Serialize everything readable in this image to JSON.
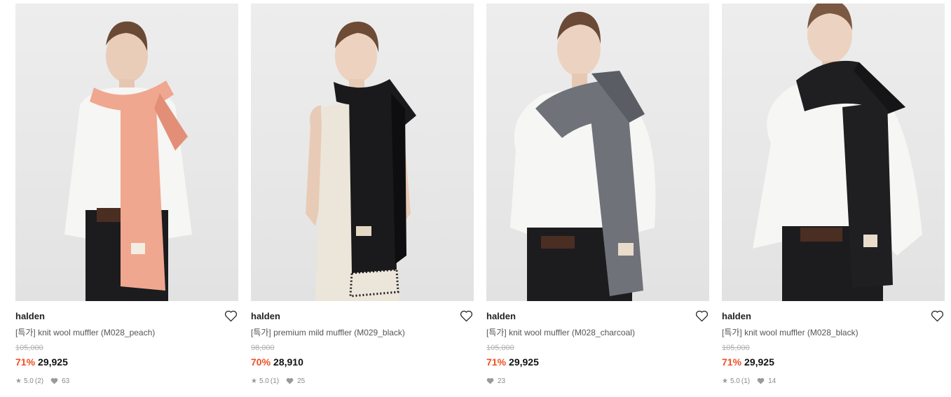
{
  "products": [
    {
      "brand": "halden",
      "name": "[특가] knit wool muffler (M028_peach)",
      "original_price": "105,000",
      "discount": "71%",
      "price": "29,925",
      "rating": "5.0",
      "reviews": "(2)",
      "likes": "63",
      "scarf_color": "#f0a78f",
      "scarf_shade": "#e38f77",
      "top_color": "#f6f6f4",
      "bottom_color": "#1c1c1e"
    },
    {
      "brand": "halden",
      "name": "[특가] premium mild muffler (M029_black)",
      "original_price": "98,000",
      "discount": "70%",
      "price": "28,910",
      "rating": "5.0",
      "reviews": "(1)",
      "likes": "25",
      "scarf_color": "#1a1a1c",
      "scarf_shade": "#0e0e10",
      "top_color": "#ece6da",
      "bottom_color": "#e9e2d5"
    },
    {
      "brand": "halden",
      "name": "[특가] knit wool muffler (M028_charcoal)",
      "original_price": "105,000",
      "discount": "71%",
      "price": "29,925",
      "rating": "",
      "reviews": "",
      "likes": "23",
      "scarf_color": "#6f7279",
      "scarf_shade": "#5a5d64",
      "top_color": "#f6f6f4",
      "bottom_color": "#1c1c1e"
    },
    {
      "brand": "halden",
      "name": "[특가] knit wool muffler (M028_black)",
      "original_price": "105,000",
      "discount": "71%",
      "price": "29,925",
      "rating": "5.0",
      "reviews": "(1)",
      "likes": "14",
      "scarf_color": "#1f1f21",
      "scarf_shade": "#151517",
      "top_color": "#f6f6f4",
      "bottom_color": "#1c1c1e"
    }
  ],
  "icons": {
    "wishlist": "heart-outline-icon",
    "rating": "star-icon",
    "likes": "heart-filled-icon"
  }
}
